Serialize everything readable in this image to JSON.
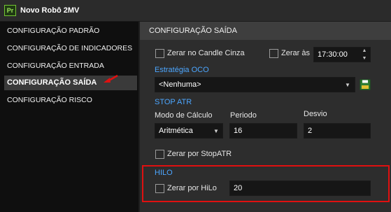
{
  "window": {
    "app_icon": "Pr",
    "title": "Novo Robô 2MV"
  },
  "sidebar": {
    "items": [
      {
        "label": "CONFIGURAÇÃO PADRÃO"
      },
      {
        "label": "CONFIGURAÇÃO DE INDICADORES"
      },
      {
        "label": "CONFIGURAÇÃO ENTRADA"
      },
      {
        "label": "CONFIGURAÇÃO SAÍDA",
        "active": true
      },
      {
        "label": "CONFIGURAÇÃO RISCO"
      }
    ]
  },
  "panel": {
    "title": "CONFIGURAÇÃO SAÍDA",
    "zerar_candle_cinza": {
      "label": "Zerar no Candle Cinza",
      "checked": false
    },
    "zerar_as": {
      "label": "Zerar às",
      "checked": false,
      "time": "17:30:00"
    },
    "estrategia_oco": {
      "section": "Estratégia OCO",
      "selected": "<Nenhuma>"
    },
    "stop_atr": {
      "section": "STOP ATR",
      "modo_label": "Modo de Cálculo",
      "modo_value": "Aritmética",
      "periodo_label": "Periodo",
      "periodo_value": "16",
      "desvio_label": "Desvio",
      "desvio_value": "2",
      "zerar_label": "Zerar por StopATR",
      "zerar_checked": false
    },
    "hilo": {
      "section": "HILO",
      "zerar_label": "Zerar por HiLo",
      "zerar_checked": false,
      "value": "20"
    }
  },
  "colors": {
    "section_label": "#4ca6ff",
    "highlight": "#e01010",
    "app_icon_green": "#73c532"
  },
  "icons": {
    "app": "premiere-style-app-icon",
    "save": "floppy-save-icon",
    "arrow": "red-annotation-arrow-icon"
  }
}
